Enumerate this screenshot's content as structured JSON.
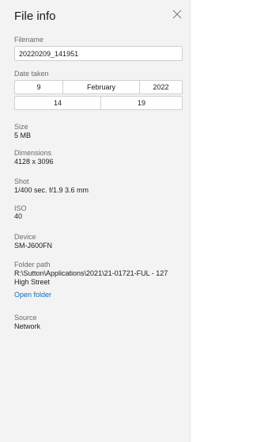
{
  "panel": {
    "title": "File info"
  },
  "filename": {
    "label": "Filename",
    "value": "20220209_141951"
  },
  "date_taken": {
    "label": "Date taken",
    "day": "9",
    "month": "February",
    "year": "2022",
    "hour": "14",
    "minute": "19"
  },
  "size": {
    "label": "Size",
    "value": "5 MB"
  },
  "dimensions": {
    "label": "Dimensions",
    "value": "4128 x 3096"
  },
  "shot": {
    "label": "Shot",
    "value": "1/400 sec. f/1.9 3.6 mm"
  },
  "iso": {
    "label": "ISO",
    "value": "40"
  },
  "device": {
    "label": "Device",
    "value": "SM-J600FN"
  },
  "folder_path": {
    "label": "Folder path",
    "value": "R:\\Sutton\\Applications\\2021\\21-01721-FUL - 127 High Street",
    "open_label": "Open folder"
  },
  "source": {
    "label": "Source",
    "value": "Network"
  },
  "icons": {
    "close": "close-icon"
  },
  "colors": {
    "link": "#0f6cbd",
    "panel_bg": "#f3f3f3"
  }
}
